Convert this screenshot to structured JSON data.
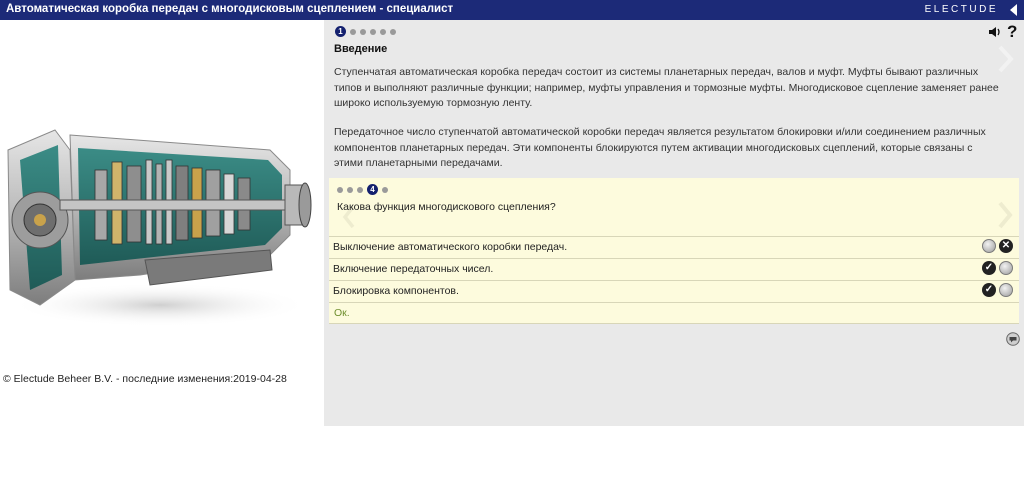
{
  "window": {
    "title": "Автоматическая коробка передач с многодисковым сцеплением - специалист",
    "brand": "ELECTUDE"
  },
  "content": {
    "section_title": "Введение",
    "paragraph1": "Ступенчатая автоматическая коробка передач состоит из системы планетарных передач, валов и муфт. Муфты бывают различных типов и выполняют различные функции; например, муфты управления и тормозные муфты. Многодисковое сцепление заменяет ранее широко используемую тормозную ленту.",
    "paragraph2": "Передаточное число ступенчатой автоматической коробки передач является результатом блокировки и/или соединением различных компонентов планетарных передач. Эти компоненты блокируются путем активации многодисковых сцеплений, которые связаны с этими планетарными передачами.",
    "top_pager": {
      "active": "1",
      "count": 6
    }
  },
  "quiz": {
    "pager": {
      "active": "4",
      "count": 5
    },
    "question": "Какова функция многодискового сцепления?",
    "options": [
      {
        "label": "Выключение автоматического коробки передач.",
        "marks": [
          "grey",
          "cross"
        ]
      },
      {
        "label": "Включение передаточных чисел.",
        "marks": [
          "check",
          "grey"
        ]
      },
      {
        "label": "Блокировка компонентов.",
        "marks": [
          "check",
          "grey"
        ]
      }
    ],
    "ok_label": "Ок."
  },
  "footer": {
    "copyright": "© Electude Beheer B.V. - последние изменения:2019-04-28"
  },
  "icons": {
    "sound": "speaker-icon",
    "help": "?",
    "comment": "comment-icon",
    "next": "chevron-right-icon",
    "prev": "chevron-left-icon"
  }
}
